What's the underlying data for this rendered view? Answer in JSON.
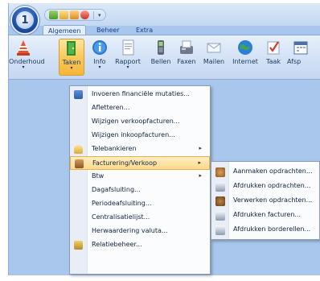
{
  "app": {
    "orb_letter": "1"
  },
  "tabs": [
    {
      "label": "Algemeen",
      "active": true
    },
    {
      "label": "Beheer",
      "active": false
    },
    {
      "label": "Extra",
      "active": false
    }
  ],
  "ribbon": {
    "buttons": [
      {
        "label": "Onderhoud",
        "icon": "traffic-cone-icon",
        "has_dropdown": true,
        "active": false
      },
      {
        "label": "Taken",
        "icon": "door-icon",
        "has_dropdown": true,
        "active": true
      },
      {
        "label": "Info",
        "icon": "info-icon",
        "has_dropdown": true,
        "active": false
      },
      {
        "label": "Rapport",
        "icon": "report-icon",
        "has_dropdown": true,
        "active": false
      },
      {
        "label": "Bellen",
        "icon": "phone-icon",
        "has_dropdown": false,
        "active": false
      },
      {
        "label": "Faxen",
        "icon": "fax-icon",
        "has_dropdown": false,
        "active": false
      },
      {
        "label": "Mailen",
        "icon": "mail-icon",
        "has_dropdown": false,
        "active": false
      },
      {
        "label": "Internet",
        "icon": "globe-icon",
        "has_dropdown": false,
        "active": false
      },
      {
        "label": "Taak",
        "icon": "task-check-icon",
        "has_dropdown": false,
        "active": false
      },
      {
        "label": "Afsp",
        "icon": "calendar-icon",
        "has_dropdown": false,
        "active": false
      }
    ],
    "dropdown_glyph": "▾"
  },
  "menu": {
    "items": [
      {
        "label": "Invoeren financiële mutaties...",
        "icon": "journal-icon",
        "submenu": false
      },
      {
        "label": "Afletteren...",
        "icon": "",
        "submenu": false
      },
      {
        "label": "Wijzigen verkoopfacturen...",
        "icon": "",
        "submenu": false
      },
      {
        "label": "Wijzigen inkoopfacturen...",
        "icon": "",
        "submenu": false
      },
      {
        "label": "Telebankieren",
        "icon": "telebanking-icon",
        "submenu": true
      },
      {
        "label": "Facturering/Verkoop",
        "icon": "invoice-box-icon",
        "submenu": true,
        "highlighted": true
      },
      {
        "label": "Btw",
        "icon": "",
        "submenu": true
      },
      {
        "label": "Dagafsluiting...",
        "icon": "",
        "submenu": false
      },
      {
        "label": "Periodeafsluiting...",
        "icon": "",
        "submenu": false
      },
      {
        "label": "Centralisatielijst...",
        "icon": "",
        "submenu": false
      },
      {
        "label": "Herwaardering valuta...",
        "icon": "",
        "submenu": false
      },
      {
        "label": "Relatiebeheer...",
        "icon": "contacts-icon",
        "submenu": false
      }
    ],
    "submenu_glyph": "▸"
  },
  "submenu": {
    "items": [
      {
        "label": "Aanmaken opdrachten...",
        "icon": "create-order-icon"
      },
      {
        "label": "Afdrukken opdrachten...",
        "icon": "print-order-icon"
      },
      {
        "label": "Verwerken opdrachten...",
        "icon": "process-order-icon"
      },
      {
        "label": "Afdrukken facturen...",
        "icon": "print-invoice-icon"
      },
      {
        "label": "Afdrukken borderellen...",
        "icon": "print-slip-icon"
      }
    ]
  },
  "colors": {
    "accent_orange": "#f6b53b",
    "highlight": "#ffd98a",
    "window_blue": "#a9c6ec"
  }
}
